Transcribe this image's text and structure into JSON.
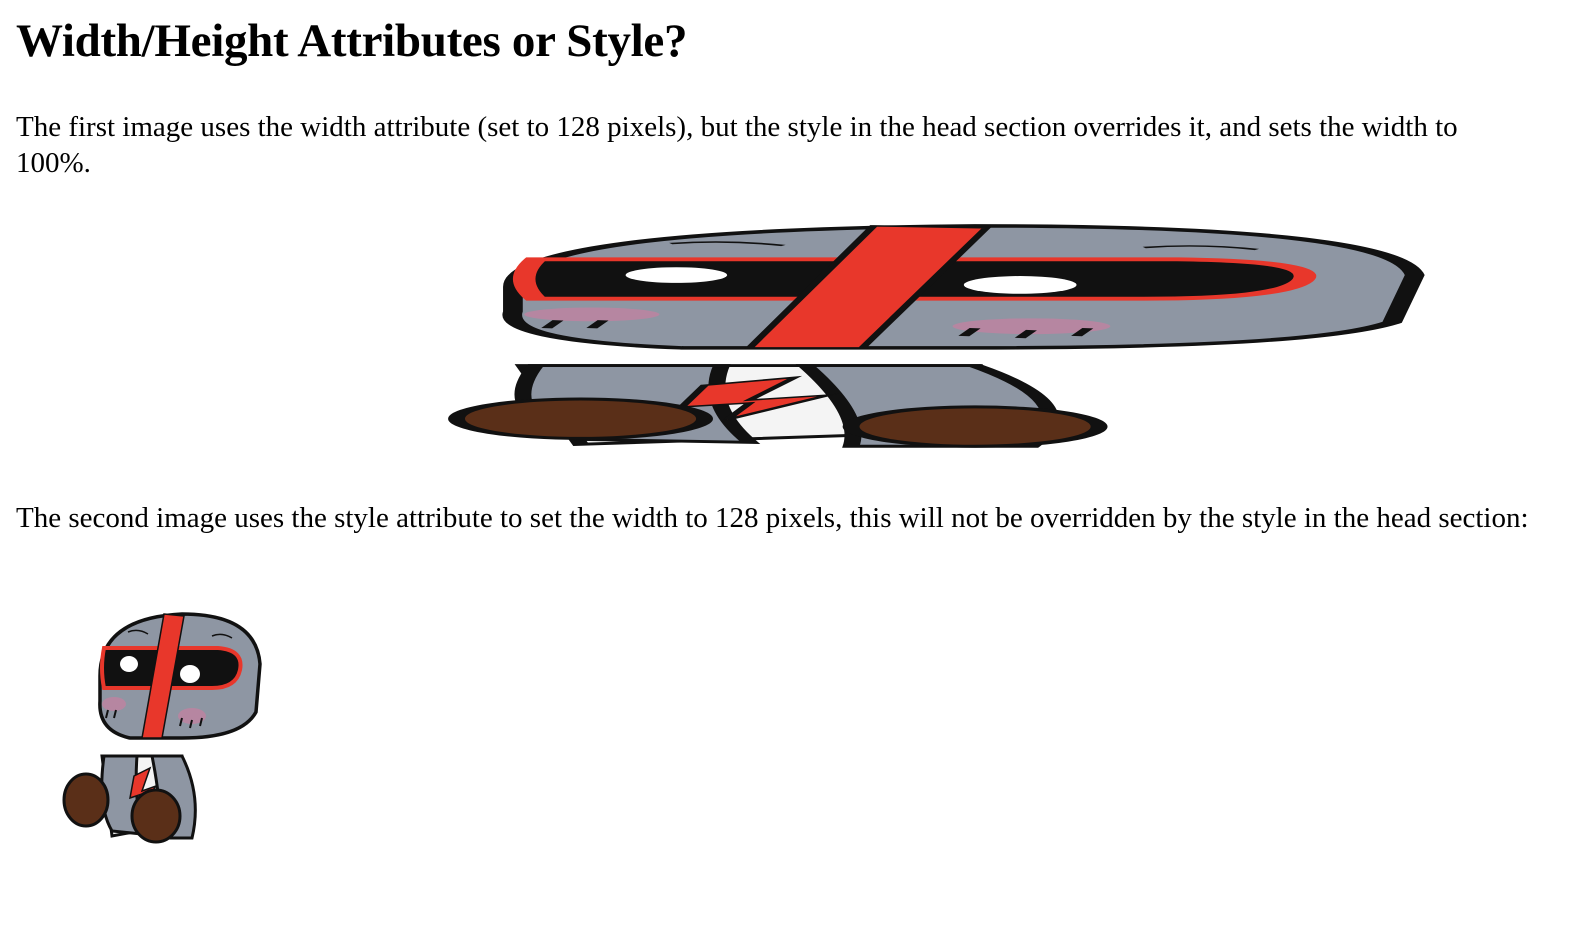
{
  "heading": "Width/Height Attributes or Style?",
  "paragraph_1": "The first image uses the width attribute (set to 128 pixels), but the style in the head section overrides it, and sets the width to 100%.",
  "paragraph_2": "The second image uses the style attribute to set the width to 128 pixels, this will not be overridden by the style in the head section:",
  "images": [
    {
      "subject": "gray plush robot character with red stripes, stretched to full width"
    },
    {
      "subject": "gray plush robot character with red stripes, 128 pixels wide"
    }
  ],
  "colors": {
    "body_gray": "#8e96a3",
    "stripe_red": "#e8372b",
    "visor_black": "#111111",
    "foot_brown": "#5a2f18",
    "blush_pink": "#d77aa0",
    "belly_white": "#f4f4f4"
  }
}
